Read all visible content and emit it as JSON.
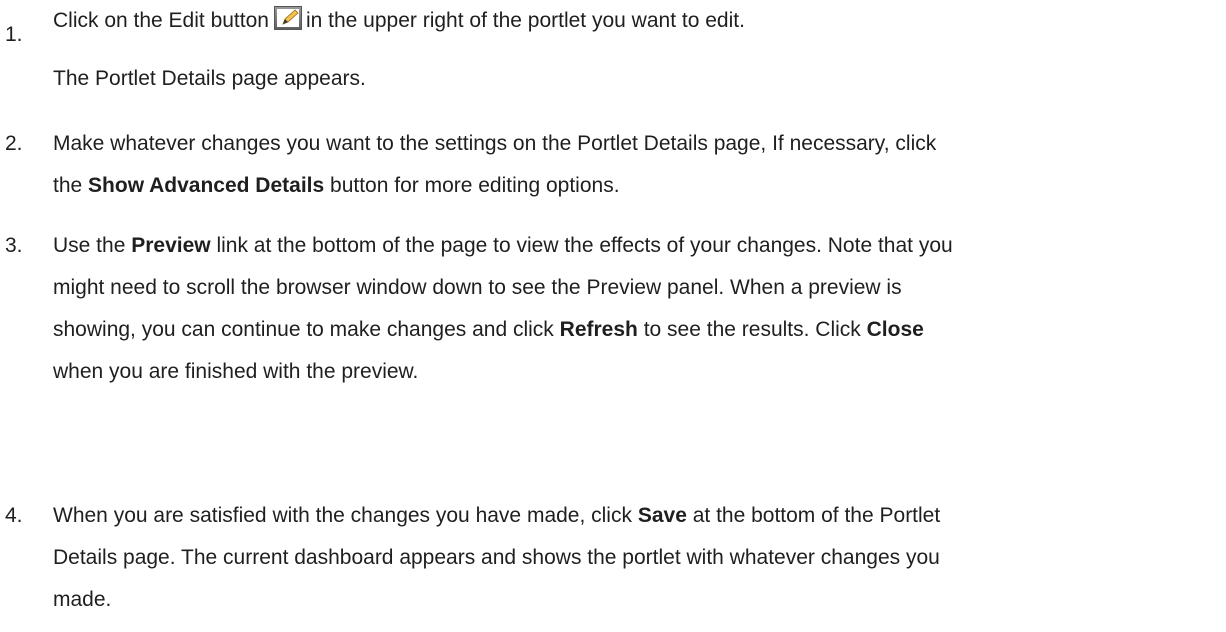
{
  "steps": [
    {
      "number": "1.",
      "part_before_icon": "Click on the Edit button",
      "part_after_icon": "in the upper right of the portlet you want to edit.",
      "icon": "edit-icon",
      "result": "The Portlet Details page appears."
    },
    {
      "number": "2.",
      "line1": "Make whatever changes you want to the settings on the Portlet Details page, If necessary, click",
      "line2_before": "the",
      "line2_bold": "Show Advanced Details",
      "line2_after": "button for more editing options."
    },
    {
      "number": "3.",
      "line1_before": "Use the",
      "line1_bold": "Preview",
      "line1_after": "link at the bottom of the page to view the effects of your changes. Note that you",
      "line2": "might need to scroll the browser window down to see the Preview panel. When a preview is",
      "line3_before": "showing, you can continue to make changes and click",
      "line3_bold1": "Refresh",
      "line3_middle": "to see the results. Click",
      "line3_bold2": "Close",
      "line4": "when you are finished with the preview."
    },
    {
      "number": "4.",
      "line1_before": "When you are satisfied with the changes you have made, click",
      "line1_bold": "Save",
      "line1_after": "at the bottom of the Portlet",
      "line2": "Details page. The current dashboard appears and shows the portlet with whatever changes you",
      "line3": "made."
    }
  ]
}
